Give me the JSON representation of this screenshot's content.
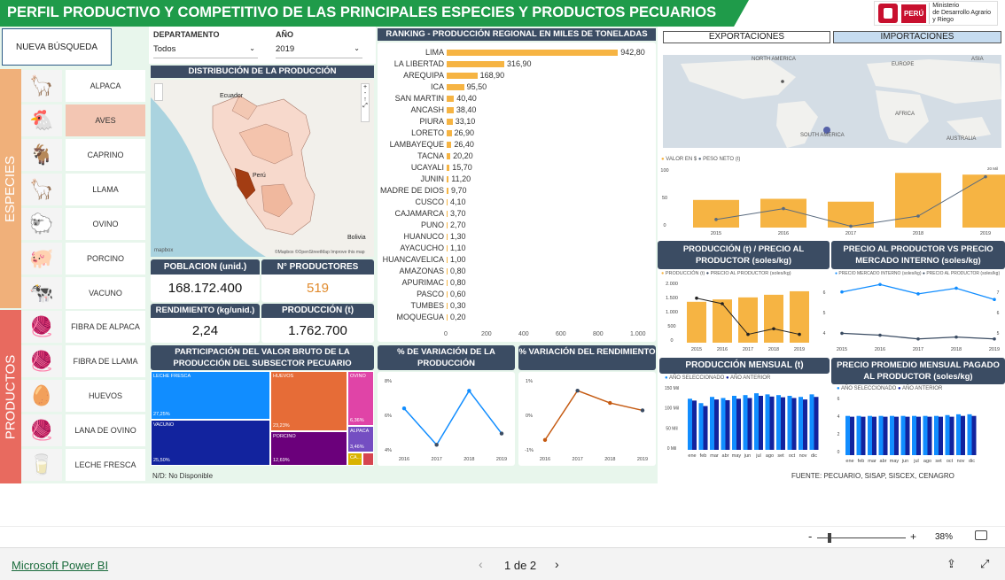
{
  "header": {
    "title": "PERFIL PRODUCTIVO Y COMPETITIVO DE LAS PRINCIPALES ESPECIES Y PRODUCTOS PECUARIOS",
    "gov_peru": "PERÚ",
    "gov_ministry_1": "Ministerio",
    "gov_ministry_2": "de Desarrollo Agrario",
    "gov_ministry_3": "y Riego"
  },
  "new_search_label": "NUEVA BÚSQUEDA",
  "filters": {
    "departamento_label": "DEPARTAMENTO",
    "departamento_value": "Todos",
    "anio_label": "AÑO",
    "anio_value": "2019"
  },
  "side": {
    "especies_label": "ESPECIES",
    "productos_label": "PRODUCTOS"
  },
  "species": [
    {
      "label": "ALPACA",
      "icon": "alpaca-icon",
      "glyph": "🦙"
    },
    {
      "label": "AVES",
      "icon": "chicken-icon",
      "glyph": "🐔"
    },
    {
      "label": "CAPRINO",
      "icon": "goat-icon",
      "glyph": "🐐"
    },
    {
      "label": "LLAMA",
      "icon": "llama-icon",
      "glyph": "🦙"
    },
    {
      "label": "OVINO",
      "icon": "sheep-icon",
      "glyph": "🐑"
    },
    {
      "label": "PORCINO",
      "icon": "pig-icon",
      "glyph": "🐖"
    },
    {
      "label": "VACUNO",
      "icon": "cow-icon",
      "glyph": "🐄"
    }
  ],
  "products": [
    {
      "label": "FIBRA DE ALPACA",
      "icon": "alpaca-fiber-icon",
      "glyph": "🧶"
    },
    {
      "label": "FIBRA DE LLAMA",
      "icon": "llama-fiber-icon",
      "glyph": "🧶"
    },
    {
      "label": "HUEVOS",
      "icon": "eggs-icon",
      "glyph": "🥚"
    },
    {
      "label": "LANA DE OVINO",
      "icon": "wool-icon",
      "glyph": "🧶"
    },
    {
      "label": "LECHE FRESCA",
      "icon": "milk-icon",
      "glyph": "🥛"
    }
  ],
  "map": {
    "title": "DISTRIBUCIÓN DE LA PRODUCCIÓN",
    "ecuador": "Ecuador",
    "peru": "Perú",
    "bolivia": "Bolivia",
    "credit": "©Mapbox ©OpenStreetMap Improve this map",
    "logo": "mapbox"
  },
  "kpis": {
    "poblacion_label": "POBLACION (unid.)",
    "poblacion_value": "168.172.400",
    "productores_label": "N° PRODUCTORES",
    "productores_value": "519",
    "rendimiento_label": "RENDIMIENTO (kg/unid.)",
    "rendimiento_value": "2,24",
    "produccion_label": "PRODUCCIÓN (t)",
    "produccion_value": "1.762.700"
  },
  "ranking": {
    "title": "RANKING - PRODUCCIÓN REGIONAL EN MILES DE TONELADAS",
    "regions": [
      "LIMA",
      "LA LIBERTAD",
      "AREQUIPA",
      "ICA",
      "SAN MARTIN",
      "ANCASH",
      "PIURA",
      "LORETO",
      "LAMBAYEQUE",
      "TACNA",
      "UCAYALI",
      "JUNIN",
      "MADRE DE DIOS",
      "CUSCO",
      "CAJAMARCA",
      "PUNO",
      "HUANUCO",
      "AYACUCHO",
      "HUANCAVELICA",
      "AMAZONAS",
      "APURIMAC",
      "PASCO",
      "TUMBES",
      "MOQUEGUA"
    ],
    "values": [
      942.8,
      316.9,
      168.9,
      95.5,
      40.4,
      38.4,
      33.1,
      26.9,
      26.4,
      20.2,
      15.7,
      11.2,
      9.7,
      4.1,
      3.7,
      2.7,
      1.3,
      1.1,
      1.0,
      0.8,
      0.8,
      0.6,
      0.3,
      0.2
    ],
    "labels": [
      "942,80",
      "316,90",
      "168,90",
      "95,50",
      "40,40",
      "38,40",
      "33,10",
      "26,90",
      "26,40",
      "20,20",
      "15,70",
      "11,20",
      "9,70",
      "4,10",
      "3,70",
      "2,70",
      "1,30",
      "1,10",
      "1,00",
      "0,80",
      "0,80",
      "0,60",
      "0,30",
      "0,20"
    ],
    "ticks": [
      "0",
      "200",
      "400",
      "600",
      "800",
      "1.000"
    ]
  },
  "trade": {
    "tab_export": "EXPORTACIONES",
    "tab_import": "IMPORTACIONES",
    "map_labels": {
      "na": "NORTH AMERICA",
      "eu": "EUROPE",
      "asia": "ASIA",
      "africa": "AFRICA",
      "sa": "SOUTH AMERICA",
      "au": "AUSTRALIA"
    },
    "legend_value": "VALOR EN $",
    "legend_weight": "PESO NETO (t)",
    "years": [
      "2015",
      "2016",
      "2017",
      "2018",
      "2019"
    ],
    "bar_values": [
      48,
      50,
      45,
      95,
      92
    ],
    "line_values": [
      13.2,
      14.8,
      12.2,
      13.7,
      19.5
    ],
    "y_ticks": [
      "100",
      "50",
      "0"
    ],
    "y2_ticks": [
      "20 Mil",
      "18 Mil",
      "16 Mil",
      "14 Mil",
      "12 Mil"
    ]
  },
  "prod_price": {
    "title": "PRODUCCIÓN (t) / PRECIO AL PRODUCTOR (soles/kg)",
    "legend_a": "PRODUCCIÓN (t)",
    "legend_b": "PRECIO AL PRODUCTOR (soles/kg)",
    "years": [
      "2015",
      "2016",
      "2017",
      "2018",
      "2019"
    ],
    "bars": [
      1400,
      1480,
      1550,
      1640,
      1760
    ],
    "line": [
      5.5,
      5.3,
      4.2,
      4.4,
      4.2
    ],
    "y_ticks": [
      "2.000",
      "1.500",
      "1.000",
      "500",
      "0"
    ],
    "y2_ticks": [
      "6",
      "5",
      "4"
    ]
  },
  "price_market": {
    "title": "PRECIO AL PRODUCTOR VS PRECIO MERCADO INTERNO (soles/kg)",
    "legend_a": "PRECIO MERCADO INTERNO (soles/kg)",
    "legend_b": "PRECIO AL PRODUCTOR (soles/kg)",
    "years": [
      "2015",
      "2016",
      "2017",
      "2018",
      "2019"
    ],
    "line_a": [
      7.2,
      7.6,
      7.1,
      7.4,
      6.8
    ],
    "line_b": [
      5.0,
      4.9,
      4.7,
      4.8,
      4.7
    ],
    "y_ticks": [
      "7",
      "6",
      "5"
    ]
  },
  "treemap": {
    "title": "PARTICIPACIÓN DEL VALOR BRUTO DE LA PRODUCCIÓN DEL SUBSECTOR PECUARIO",
    "cells": [
      {
        "name": "LECHE FRESCA",
        "pct": "27,25%",
        "color": "#118dff"
      },
      {
        "name": "VACUNO",
        "pct": "25,50%",
        "color": "#12239e"
      },
      {
        "name": "HUEVOS",
        "pct": "23,23%",
        "color": "#e66c37"
      },
      {
        "name": "PORCINO",
        "pct": "12,69%",
        "color": "#6b007b"
      },
      {
        "name": "OVINO",
        "pct": "6,36%",
        "color": "#e044a7"
      },
      {
        "name": "ALPACA",
        "pct": "3,46%",
        "color": "#744ec2"
      },
      {
        "name": "CA...",
        "pct": "",
        "color": "#d9b300"
      },
      {
        "name": "",
        "pct": "",
        "color": "#d64550"
      }
    ]
  },
  "var_prod": {
    "title": "% DE VARIACIÓN DE LA PRODUCCIÓN",
    "years": [
      "2016",
      "2017",
      "2018",
      "2019"
    ],
    "values": [
      6.3,
      3.4,
      7.7,
      4.3
    ],
    "y_ticks": [
      "8%",
      "6%",
      "4%"
    ]
  },
  "var_rend": {
    "title": "% VARIACIÓN DEL RENDIMIENTO",
    "years": [
      "2016",
      "2017",
      "2018",
      "2019"
    ],
    "values": [
      -0.8,
      1.2,
      0.7,
      0.4
    ],
    "y_ticks": [
      "1%",
      "0%",
      "-1%"
    ]
  },
  "monthly_prod": {
    "title": "PRODUCCIÓN MENSUAL (t)",
    "legend_a": "AÑO SELECCIONADO",
    "legend_b": "AÑO ANTERIOR",
    "months": [
      "ene",
      "feb",
      "mar",
      "abr",
      "may",
      "jun",
      "jul",
      "ago",
      "set",
      "oct",
      "nov",
      "dic"
    ],
    "sel": [
      140,
      128,
      145,
      142,
      148,
      150,
      155,
      152,
      150,
      148,
      145,
      152
    ],
    "prev": [
      135,
      120,
      138,
      136,
      140,
      142,
      148,
      146,
      144,
      142,
      138,
      145
    ],
    "y_ticks": [
      "150 Mil",
      "100 Mil",
      "50 Mil",
      "0 Mil"
    ]
  },
  "monthly_price": {
    "title": "PRECIO PROMEDIO MENSUAL PAGADO AL PRODUCTOR (soles/kg)",
    "legend_a": "AÑO SELECCIONADO",
    "legend_b": "AÑO ANTERIOR",
    "months": [
      "ene",
      "feb",
      "mar",
      "abr",
      "may",
      "jun",
      "jul",
      "ago",
      "set",
      "oct",
      "nov",
      "dic"
    ],
    "sel": [
      4.8,
      4.8,
      4.8,
      4.8,
      4.8,
      4.8,
      4.8,
      4.8,
      4.8,
      4.9,
      5.0,
      5.0
    ],
    "prev": [
      4.7,
      4.7,
      4.7,
      4.7,
      4.7,
      4.7,
      4.7,
      4.7,
      4.7,
      4.7,
      4.8,
      4.8
    ],
    "y_ticks": [
      "6",
      "4",
      "2",
      "0"
    ]
  },
  "notes": {
    "nd": "N/D: No Disponible",
    "fuente": "FUENTE: PECUARIO, SISAP, SISCEX, CENAGRO"
  },
  "zoom": {
    "minus": "-",
    "plus": "+",
    "level": "38%"
  },
  "footer": {
    "powerbi": "Microsoft Power BI",
    "page": "1 de 2"
  }
}
